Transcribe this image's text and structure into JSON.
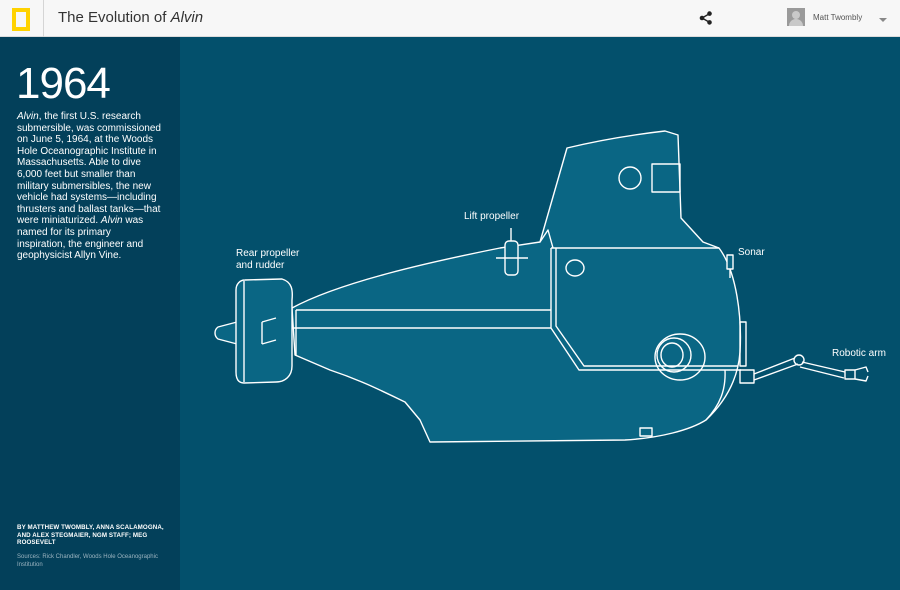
{
  "header": {
    "title_prefix": "The Evolution of ",
    "title_emphasis": "Alvin",
    "share_icon": "share-icon",
    "user": {
      "name": "Matt Twombly",
      "avatar_icon": "avatar-icon",
      "menu_icon": "chevron-down-icon"
    },
    "logo_icon": "nat-geo-logo-icon",
    "colors": {
      "logo_yellow": "#ffd200",
      "bar_bg": "#f7f7f7"
    }
  },
  "sidebar": {
    "year": "1964",
    "description": {
      "p1_italic": "Alvin",
      "p1": ", the first U.S. research submersible, was commissioned on June 5, 1964, at the Woods Hole Oceanographic Institute in Massachusetts. Able to dive 6,000 feet but smaller than military submersibles, the new vehicle had systems—including thrusters and ballast tanks—that were miniaturized. ",
      "p2_italic": "Alvin",
      "p2": " was named for its primary inspiration, the engineer and geophysicist Allyn Vine."
    },
    "byline": "BY MATTHEW TWOMBLY, ANNA SCALAMOGNA, AND ALEX STEGMAIER, NGM STAFF; MEG ROOSEVELT",
    "sources": "Sources: Rick Chandler, Woods Hole Oceanographic Institution",
    "colors": {
      "bg": "#03405a"
    }
  },
  "diagram": {
    "labels": {
      "rear_propeller_line1": "Rear propeller",
      "rear_propeller_line2": "and rudder",
      "lift_propeller": "Lift propeller",
      "sonar": "Sonar",
      "robotic_arm": "Robotic arm"
    },
    "colors": {
      "bg": "#03506c",
      "hull": "#0a6684",
      "line": "#ffffff"
    }
  }
}
